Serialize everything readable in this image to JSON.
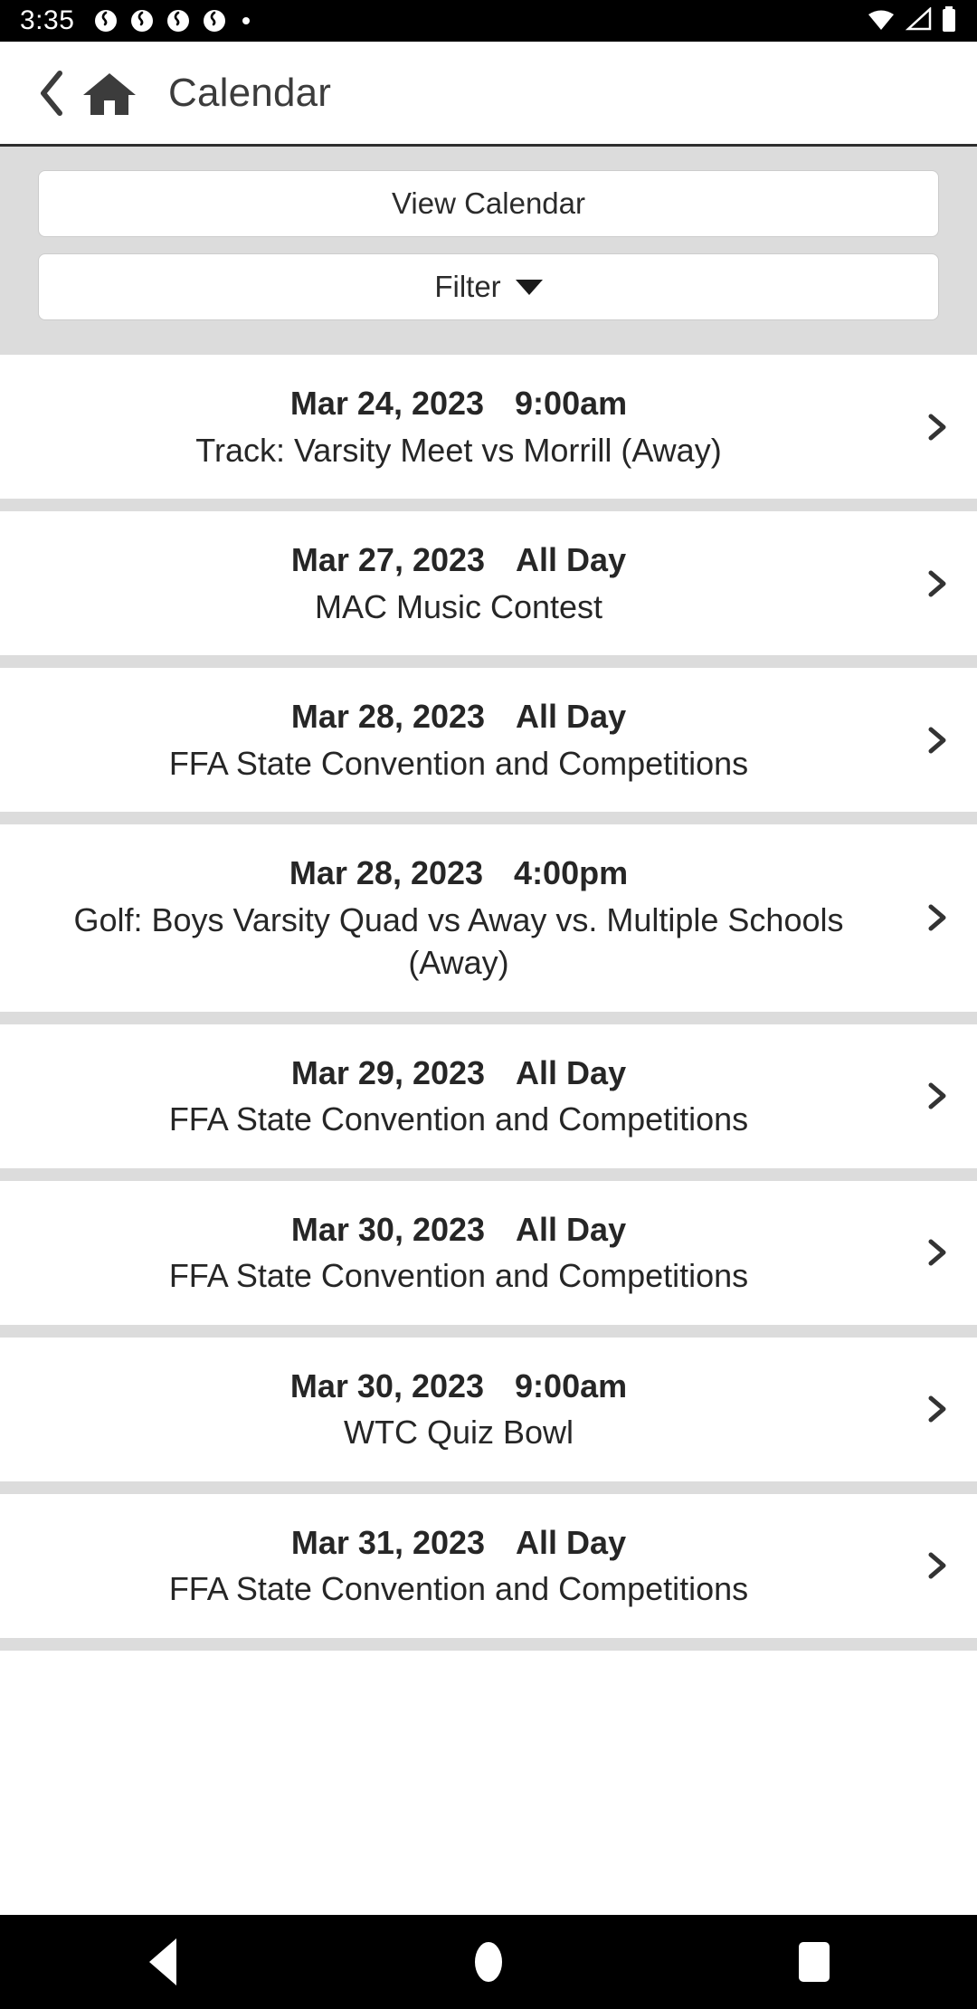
{
  "status_bar": {
    "time": "3:35",
    "left_icons": [
      "app-swirl-icon",
      "app-swirl-icon",
      "app-swirl-icon",
      "app-swirl-icon",
      "dot-icon"
    ],
    "right_icons": [
      "wifi-icon",
      "cellular-signal-icon",
      "battery-icon"
    ]
  },
  "header": {
    "back_icon": "chevron-left-icon",
    "home_icon": "home-icon",
    "title": "Calendar"
  },
  "toolbar": {
    "view_calendar_label": "View Calendar",
    "filter_label": "Filter",
    "filter_caret_icon": "caret-down-icon"
  },
  "events": [
    {
      "date": "Mar 24, 2023",
      "time": "9:00am",
      "title": "Track: Varsity Meet vs Morrill (Away)"
    },
    {
      "date": "Mar 27, 2023",
      "time": "All Day",
      "title": "MAC Music Contest"
    },
    {
      "date": "Mar 28, 2023",
      "time": "All Day",
      "title": "FFA State Convention and Competitions"
    },
    {
      "date": "Mar 28, 2023",
      "time": "4:00pm",
      "title": "Golf: Boys Varsity Quad vs Away vs. Multiple Schools (Away)"
    },
    {
      "date": "Mar 29, 2023",
      "time": "All Day",
      "title": "FFA State Convention and Competitions"
    },
    {
      "date": "Mar 30, 2023",
      "time": "All Day",
      "title": "FFA State Convention and Competitions"
    },
    {
      "date": "Mar 30, 2023",
      "time": "9:00am",
      "title": "WTC Quiz Bowl"
    },
    {
      "date": "Mar 31, 2023",
      "time": "All Day",
      "title": "FFA State Convention and Competitions"
    }
  ],
  "row_chevron_icon": "chevron-right-icon",
  "nav_bar": {
    "back_icon": "nav-back-triangle-icon",
    "home_icon": "nav-home-circle-icon",
    "recents_icon": "nav-recents-square-icon"
  },
  "colors": {
    "status_bar_bg": "#000000",
    "header_text": "#3c3c3c",
    "toolbar_bg": "#dcdcdc",
    "separator": "#dcdcdc",
    "row_text": "#262626",
    "nav_bar_bg": "#000000"
  }
}
